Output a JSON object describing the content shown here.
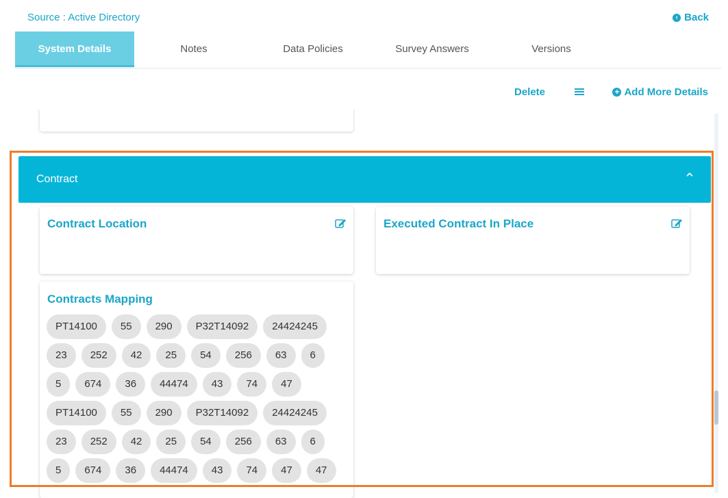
{
  "header": {
    "source_label": "Source : Active Directory",
    "back_label": "Back"
  },
  "tabs": [
    {
      "label": "System Details",
      "active": true
    },
    {
      "label": "Notes",
      "active": false
    },
    {
      "label": "Data Policies",
      "active": false
    },
    {
      "label": "Survey Answers",
      "active": false
    },
    {
      "label": "Versions",
      "active": false
    }
  ],
  "toolbar": {
    "delete_label": "Delete",
    "add_more_label": "Add More Details"
  },
  "section": {
    "title": "Contract",
    "cards": {
      "contract_location": {
        "title": "Contract Location"
      },
      "executed_contract": {
        "title": "Executed Contract In Place"
      },
      "contracts_mapping": {
        "title": "Contracts Mapping",
        "rows": [
          [
            "PT14100",
            "55",
            "290",
            "P32T14092",
            "24424245"
          ],
          [
            "23",
            "252",
            "42",
            "25",
            "54",
            "256",
            "63",
            "6"
          ],
          [
            "5",
            "674",
            "36",
            "44474",
            "43",
            "74",
            "47"
          ],
          [
            "PT14100",
            "55",
            "290",
            "P32T14092",
            "24424245"
          ],
          [
            "23",
            "252",
            "42",
            "25",
            "54",
            "256",
            "63",
            "6"
          ],
          [
            "5",
            "674",
            "36",
            "44474",
            "43",
            "74",
            "47",
            "47"
          ]
        ]
      }
    }
  },
  "colors": {
    "accent": "#1aa6c9",
    "section_header": "#05b5d8",
    "active_tab": "#6bcfe3",
    "highlight": "#f07b2a",
    "pill_bg": "#e3e3e3"
  }
}
